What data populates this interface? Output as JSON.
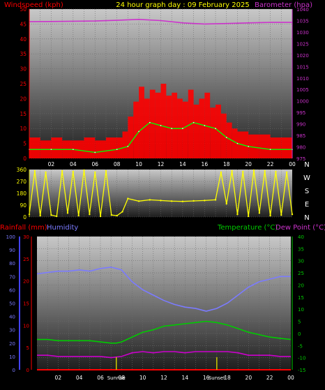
{
  "header": {
    "left_title": "Windspeed (kph)",
    "center_title": "24 hour graph day : 09 February 2025",
    "right_title": "Barometer (hpa)"
  },
  "bottom_header": {
    "rainfall_label": "Rainfall (mm)",
    "humidity_label": "Humidity",
    "temperature_label": "Temperature (°C)",
    "dewpoint_label": "Dew Point (°C)"
  },
  "colors": {
    "wind": "#ff0000",
    "barometer": "#cc33cc",
    "direction": "#ffff00",
    "humidity": "#7b7bff",
    "temperature": "#00cc00",
    "dewpoint": "#cc00cc",
    "rain": "#ff0000",
    "sun": "#cccc00"
  },
  "chart_data": [
    {
      "type": "line",
      "title": "24 hour graph day : 09 February 2025",
      "xlabel": "",
      "x_ticks": [
        "02",
        "04",
        "06",
        "08",
        "10",
        "12",
        "14",
        "16",
        "18",
        "20",
        "22",
        "00"
      ],
      "x_range_hours": [
        0,
        24
      ],
      "left_axis": {
        "label": "Windspeed (kph)",
        "range": [
          0,
          50
        ],
        "ticks": [
          "0",
          "5",
          "10",
          "15",
          "20",
          "25",
          "30",
          "35",
          "40",
          "45",
          "50"
        ]
      },
      "right_axis": {
        "label": "Barometer (hpa)",
        "range": [
          975,
          1040
        ],
        "ticks": [
          "975",
          "980",
          "985",
          "990",
          "995",
          "1000",
          "1005",
          "1010",
          "1015",
          "1020",
          "1025",
          "1030",
          "1035",
          "1040"
        ]
      },
      "grid": true,
      "series": [
        {
          "name": "Windspeed (kph)",
          "style": "gust",
          "axis": "left",
          "x": [
            0,
            1,
            2,
            3,
            4,
            5,
            6,
            7,
            8,
            8.5,
            9,
            9.5,
            10,
            10.5,
            11,
            11.5,
            12,
            12.5,
            13,
            13.5,
            14,
            14.5,
            15,
            15.5,
            16,
            16.5,
            17,
            17.5,
            18,
            18.5,
            19,
            20,
            21,
            22,
            23,
            24
          ],
          "values": [
            7,
            6,
            7,
            6,
            6,
            7,
            6,
            7,
            7,
            9,
            14,
            19,
            24,
            20,
            23,
            22,
            25,
            21,
            22,
            20,
            19,
            23,
            18,
            20,
            22,
            17,
            18,
            15,
            12,
            10,
            9,
            8,
            8,
            7,
            7,
            6
          ]
        },
        {
          "name": "Average wind",
          "style": "average",
          "axis": "left",
          "x": [
            0,
            2,
            4,
            6,
            8,
            9,
            10,
            11,
            12,
            13,
            14,
            15,
            16,
            17,
            18,
            19,
            20,
            22,
            24
          ],
          "values": [
            3,
            3,
            3,
            2,
            3,
            4,
            9,
            12,
            11,
            10,
            10,
            12,
            11,
            10,
            7,
            5,
            4,
            3,
            3
          ]
        },
        {
          "name": "Barometer (hpa)",
          "axis": "right",
          "x": [
            0,
            2,
            4,
            6,
            8,
            10,
            12,
            14,
            16,
            18,
            20,
            22,
            24
          ],
          "values": [
            1034.5,
            1034.6,
            1034.7,
            1034.8,
            1035.1,
            1035.5,
            1035.0,
            1034.0,
            1033.5,
            1033.7,
            1034.0,
            1034.2,
            1034.2
          ]
        }
      ]
    },
    {
      "type": "scatter",
      "title": "",
      "xlabel": "",
      "x_range_hours": [
        0,
        24
      ],
      "y_axis": {
        "range": [
          0,
          360
        ],
        "ticks": [
          "0",
          "90",
          "180",
          "270",
          "360"
        ]
      },
      "compass_labels": [
        "N",
        "W",
        "S",
        "E",
        "N"
      ],
      "grid": true,
      "series": [
        {
          "name": "Wind direction",
          "axis": "left",
          "x": [
            0,
            0.5,
            1,
            1.5,
            2,
            2.5,
            3,
            3.5,
            4,
            4.5,
            5,
            5.5,
            6,
            6.5,
            7,
            7.5,
            8,
            8.5,
            9,
            10,
            11,
            12,
            13,
            14,
            15,
            16,
            17,
            17.5,
            18,
            18.5,
            19,
            19.5,
            20,
            20.5,
            21,
            21.5,
            22,
            22.5,
            23,
            23.5,
            24
          ],
          "values": [
            20,
            350,
            10,
            340,
            15,
            5,
            350,
            30,
            345,
            10,
            355,
            20,
            340,
            5,
            350,
            15,
            10,
            40,
            140,
            120,
            130,
            125,
            120,
            118,
            122,
            125,
            130,
            340,
            100,
            350,
            20,
            345,
            5,
            355,
            30,
            350,
            10,
            345,
            15,
            340,
            20
          ]
        }
      ]
    },
    {
      "type": "line",
      "title": "",
      "xlabel": "",
      "x_ticks": [
        "02",
        "04",
        "06",
        "08",
        "10",
        "12",
        "14",
        "16",
        "18",
        "20",
        "22",
        "00"
      ],
      "x_range_hours": [
        0,
        24
      ],
      "humidity_axis": {
        "label": "Humidity",
        "range": [
          0,
          100
        ],
        "ticks": [
          "0",
          "10",
          "20",
          "30",
          "40",
          "50",
          "60",
          "70",
          "80",
          "90",
          "100"
        ]
      },
      "rain_axis": {
        "label": "Rainfall (mm)",
        "range": [
          0,
          30
        ],
        "ticks": [
          "0",
          "5",
          "10",
          "15",
          "20",
          "25",
          "30"
        ]
      },
      "temp_axis": {
        "label": "Temperature (°C)",
        "range": [
          -15,
          40
        ],
        "ticks": [
          "-15",
          "-10",
          "-5",
          "0",
          "5",
          "10",
          "15",
          "20",
          "25",
          "30",
          "35",
          "40"
        ]
      },
      "sun_labels": [
        "Sunrise",
        "Sunset"
      ],
      "sun_times": [
        7.5,
        17.0
      ],
      "grid": true,
      "series": [
        {
          "name": "Humidity",
          "axis": "humidity",
          "x": [
            0,
            1,
            2,
            3,
            4,
            5,
            6,
            7,
            7.5,
            8,
            9,
            10,
            11,
            12,
            13,
            14,
            15,
            16,
            17,
            18,
            19,
            20,
            21,
            22,
            23,
            24
          ],
          "values": [
            72,
            73,
            74,
            74,
            75,
            74,
            76,
            77,
            76,
            75,
            66,
            60,
            56,
            52,
            49,
            47,
            46,
            44,
            46,
            50,
            56,
            62,
            66,
            68,
            70,
            70
          ]
        },
        {
          "name": "Temperature (°C)",
          "axis": "temp",
          "x": [
            0,
            1,
            2,
            3,
            4,
            5,
            6,
            7,
            7.5,
            8,
            9,
            10,
            11,
            12,
            13,
            14,
            15,
            16,
            17,
            18,
            19,
            20,
            21,
            22,
            23,
            24
          ],
          "values": [
            -2.5,
            -2.5,
            -3,
            -3,
            -3,
            -3,
            -3.5,
            -4,
            -4,
            -3.5,
            -1.5,
            0.5,
            1.5,
            3,
            3.5,
            4,
            4.5,
            5,
            4.5,
            3.5,
            2,
            0.5,
            -0.5,
            -1.5,
            -2,
            -2.5
          ]
        },
        {
          "name": "Dew Point (°C)",
          "axis": "temp",
          "x": [
            0,
            1,
            2,
            3,
            4,
            5,
            6,
            7,
            8,
            9,
            10,
            11,
            12,
            13,
            14,
            15,
            16,
            17,
            18,
            19,
            20,
            21,
            22,
            23,
            24
          ],
          "values": [
            -9,
            -9,
            -9.5,
            -9.5,
            -9.5,
            -9.5,
            -9.5,
            -10,
            -9.5,
            -8,
            -7.5,
            -8,
            -7.5,
            -7.5,
            -8,
            -7.5,
            -7.5,
            -7.5,
            -7.5,
            -8,
            -9,
            -9,
            -9,
            -9.5,
            -9.5
          ]
        },
        {
          "name": "Rainfall (mm)",
          "axis": "rain",
          "x": [
            0,
            24
          ],
          "values": [
            0,
            0
          ]
        }
      ]
    }
  ]
}
